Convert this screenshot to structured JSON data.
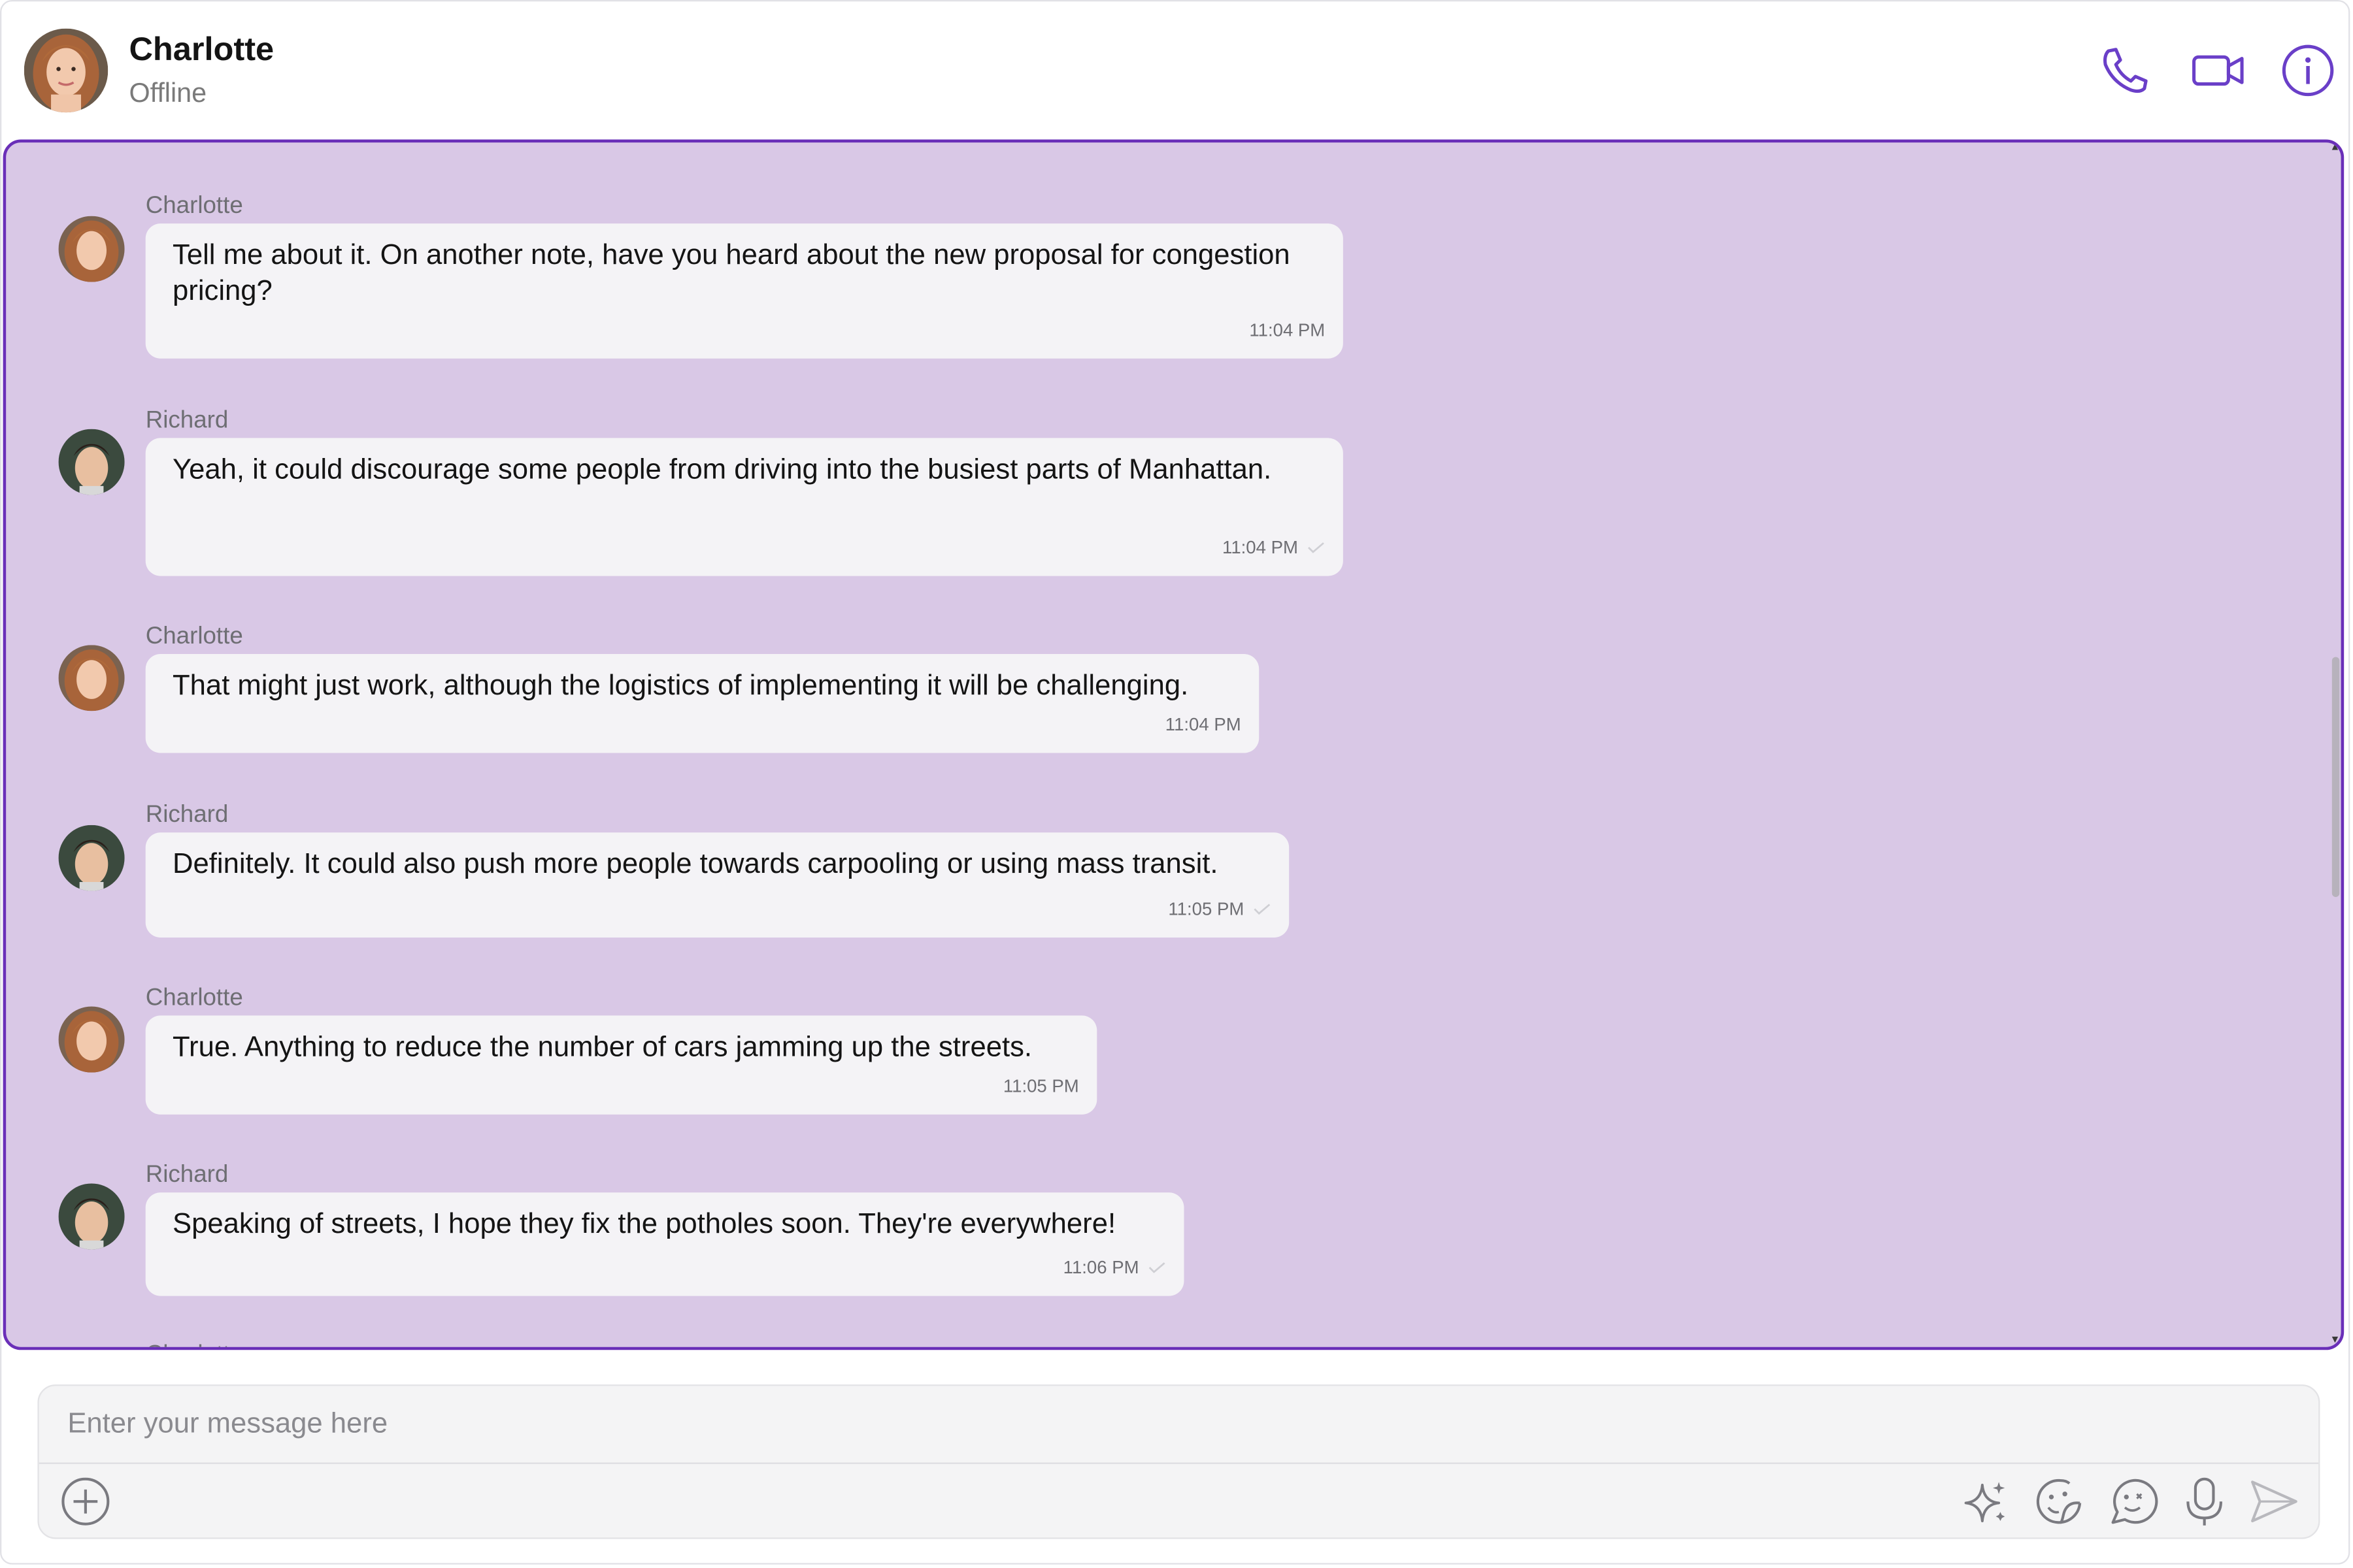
{
  "header": {
    "name": "Charlotte",
    "status": "Offline"
  },
  "icons": {
    "call": "phone-icon",
    "video": "video-camera-icon",
    "info": "info-icon",
    "attach": "plus-circle-icon",
    "ai": "sparkle-icon",
    "sticker": "sticker-icon",
    "emoji": "emoji-icon",
    "mic": "microphone-icon",
    "send": "send-icon"
  },
  "colors": {
    "accent": "#6a3fc8",
    "chat_background": "#d9c8e6",
    "bubble": "#f4f3f6"
  },
  "messages": [
    {
      "sender": "Charlotte",
      "text": "Tell me about it. On another note, have you heard about the new proposal for congestion pricing?",
      "time": "11:04 PM",
      "read_receipt": false
    },
    {
      "sender": "Richard",
      "text": "Yeah, it could discourage some people from driving into the busiest parts of Manhattan.",
      "time": "11:04 PM",
      "read_receipt": true
    },
    {
      "sender": "Charlotte",
      "text": "That might just work, although the logistics of implementing it will be challenging.",
      "time": "11:04 PM",
      "read_receipt": false
    },
    {
      "sender": "Richard",
      "text": "Definitely. It could also push more people towards carpooling or using mass transit.",
      "time": "11:05 PM",
      "read_receipt": true
    },
    {
      "sender": "Charlotte",
      "text": "True. Anything to reduce the number of cars jamming up the streets.",
      "time": "11:05 PM",
      "read_receipt": false
    },
    {
      "sender": "Richard",
      "text": "Speaking of streets, I hope they fix the potholes soon. They're everywhere!",
      "time": "11:06 PM",
      "read_receipt": true
    }
  ],
  "partial_sender": "Charlotte",
  "composer": {
    "placeholder": "Enter your message here"
  }
}
